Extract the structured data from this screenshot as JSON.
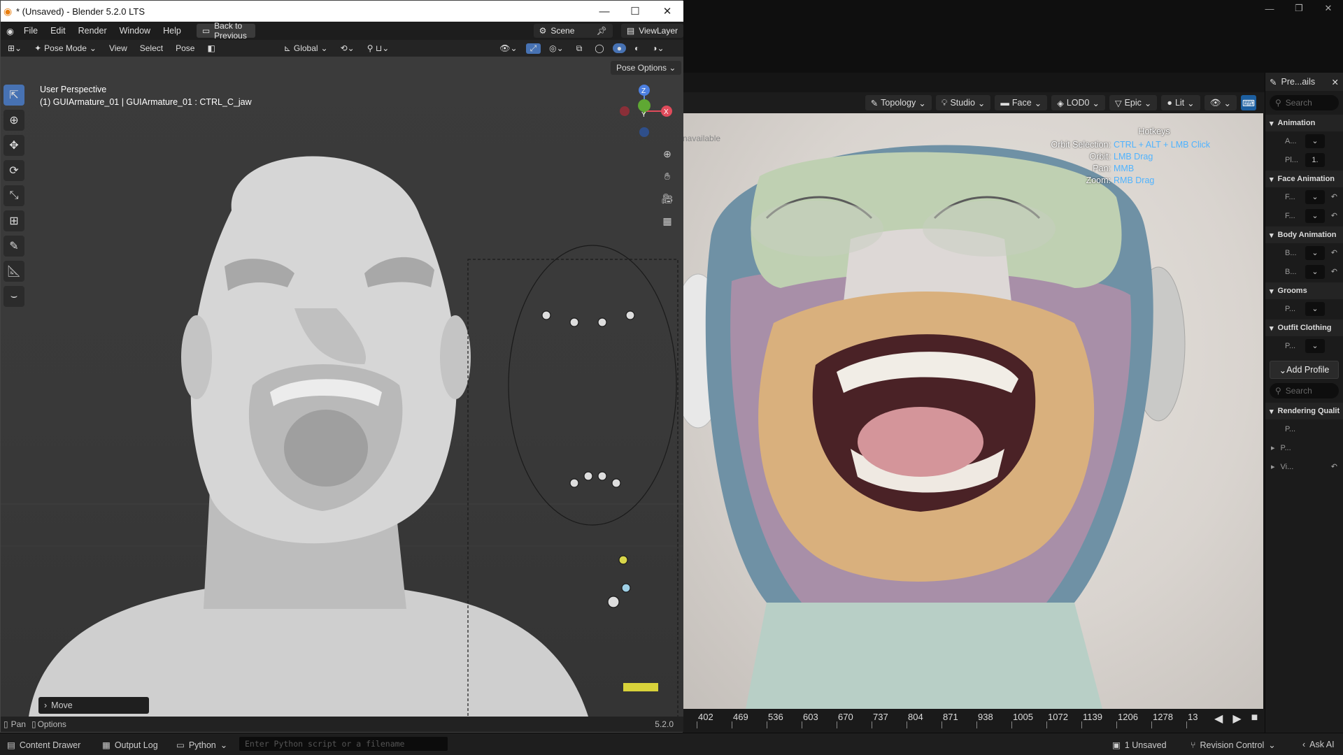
{
  "blender": {
    "window_title": "* (Unsaved) - Blender 5.2.0 LTS",
    "menu": [
      "File",
      "Edit",
      "Render",
      "Window",
      "Help"
    ],
    "back_button": "Back to Previous",
    "scene_label": "Scene",
    "viewlayer_label": "ViewLayer",
    "header": {
      "mode": "Pose Mode",
      "items": [
        "View",
        "Select",
        "Pose"
      ],
      "orientation": "Global"
    },
    "pose_options": "Pose Options",
    "viewport": {
      "perspective": "User Perspective",
      "object_info": "(1) GUIArmature_01 | GUIArmature_01 : CTRL_C_jaw"
    },
    "gizmo_axes": [
      "Z",
      "Y",
      "X"
    ],
    "operator_panel": "Move",
    "status": {
      "left": "Pan",
      "options": "Options",
      "version": "5.2.0"
    },
    "icons": [
      "blender-logo-icon",
      "cursor-icon",
      "move-icon",
      "rotate-icon",
      "scale-icon",
      "transform-icon",
      "annotate-icon",
      "measure-icon",
      "bone-roll-icon",
      "zoom-icon",
      "hand-icon",
      "camera-icon",
      "grid-icon"
    ]
  },
  "unreal": {
    "viewport_toolbar": [
      "Topology",
      "Studio",
      "Face",
      "LOD0",
      "Epic",
      "Lit"
    ],
    "hotkeys": {
      "title": "Hotkeys",
      "rows": [
        {
          "key": "Orbit Selection:",
          "value": "CTRL + ALT + LMB Click"
        },
        {
          "key": "Orbit:",
          "value": "LMB Drag"
        },
        {
          "key": "Pan:",
          "value": "MMB"
        },
        {
          "key": "Zoom:",
          "value": "RMB Drag"
        }
      ]
    },
    "unavailable_text": "navailable",
    "details": {
      "title": "Pre...ails",
      "search_placeholder": "Search",
      "sections": [
        {
          "name": "Animation",
          "props": [
            {
              "label": "A...",
              "value": ""
            },
            {
              "label": "Pl...",
              "value": "1."
            }
          ]
        },
        {
          "name": "Face Animation",
          "props": [
            {
              "label": "F...",
              "value": ""
            },
            {
              "label": "F...",
              "value": ""
            }
          ]
        },
        {
          "name": "Body Animation",
          "props": [
            {
              "label": "B...",
              "value": ""
            },
            {
              "label": "B...",
              "value": ""
            }
          ]
        },
        {
          "name": "Grooms",
          "props": [
            {
              "label": "P...",
              "value": ""
            }
          ]
        },
        {
          "name": "Outfit Clothing",
          "props": [
            {
              "label": "P...",
              "value": ""
            }
          ]
        }
      ],
      "add_profile": "Add Profile",
      "search2_placeholder": "Search",
      "rendering": {
        "name": "Rendering Qualit",
        "props": [
          "P...",
          "P...",
          "Vi..."
        ]
      }
    },
    "timeline_ticks": [
      "402",
      "469",
      "536",
      "603",
      "670",
      "737",
      "804",
      "871",
      "938",
      "1005",
      "1072",
      "1139",
      "1206",
      "1278",
      "13"
    ],
    "status_bar": {
      "content_drawer": "Content Drawer",
      "output_log": "Output Log",
      "python": "Python",
      "python_placeholder": "Enter Python script or a filename",
      "unsaved": "1 Unsaved",
      "revision": "Revision Control",
      "ask_ai": "Ask AI"
    }
  }
}
